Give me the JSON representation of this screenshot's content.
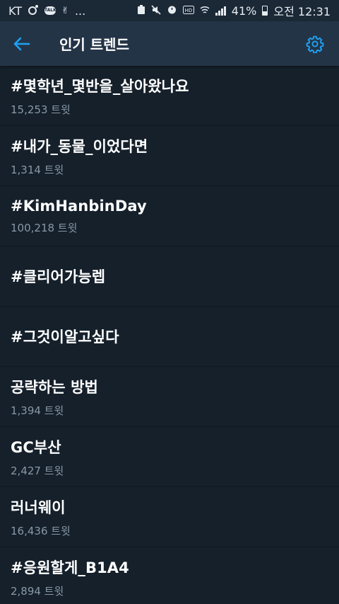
{
  "status_bar": {
    "carrier": "KT",
    "talk_label": "TALK",
    "more": "...",
    "battery_percent": "41%",
    "time": "오전 12:31"
  },
  "header": {
    "title": "인기 트렌드"
  },
  "trends": [
    {
      "name": "#몇학년_몇반을_살아왔나요",
      "count": "15,253 트윗"
    },
    {
      "name": "#내가_동물_이었다면",
      "count": "1,314 트윗"
    },
    {
      "name": "#KimHanbinDay",
      "count": "100,218 트윗"
    },
    {
      "name": "#클리어가능렙",
      "count": ""
    },
    {
      "name": "#그것이알고싶다",
      "count": ""
    },
    {
      "name": "공략하는 방법",
      "count": "1,394 트윗"
    },
    {
      "name": "GC부산",
      "count": "2,427 트윗"
    },
    {
      "name": "러너웨이",
      "count": "16,436 트윗"
    },
    {
      "name": "#응원할게_B1A4",
      "count": "2,894 트윗"
    }
  ],
  "colors": {
    "accent": "#1da1f2",
    "background": "#15202b",
    "header": "#243447",
    "secondary_text": "#8899a6"
  }
}
